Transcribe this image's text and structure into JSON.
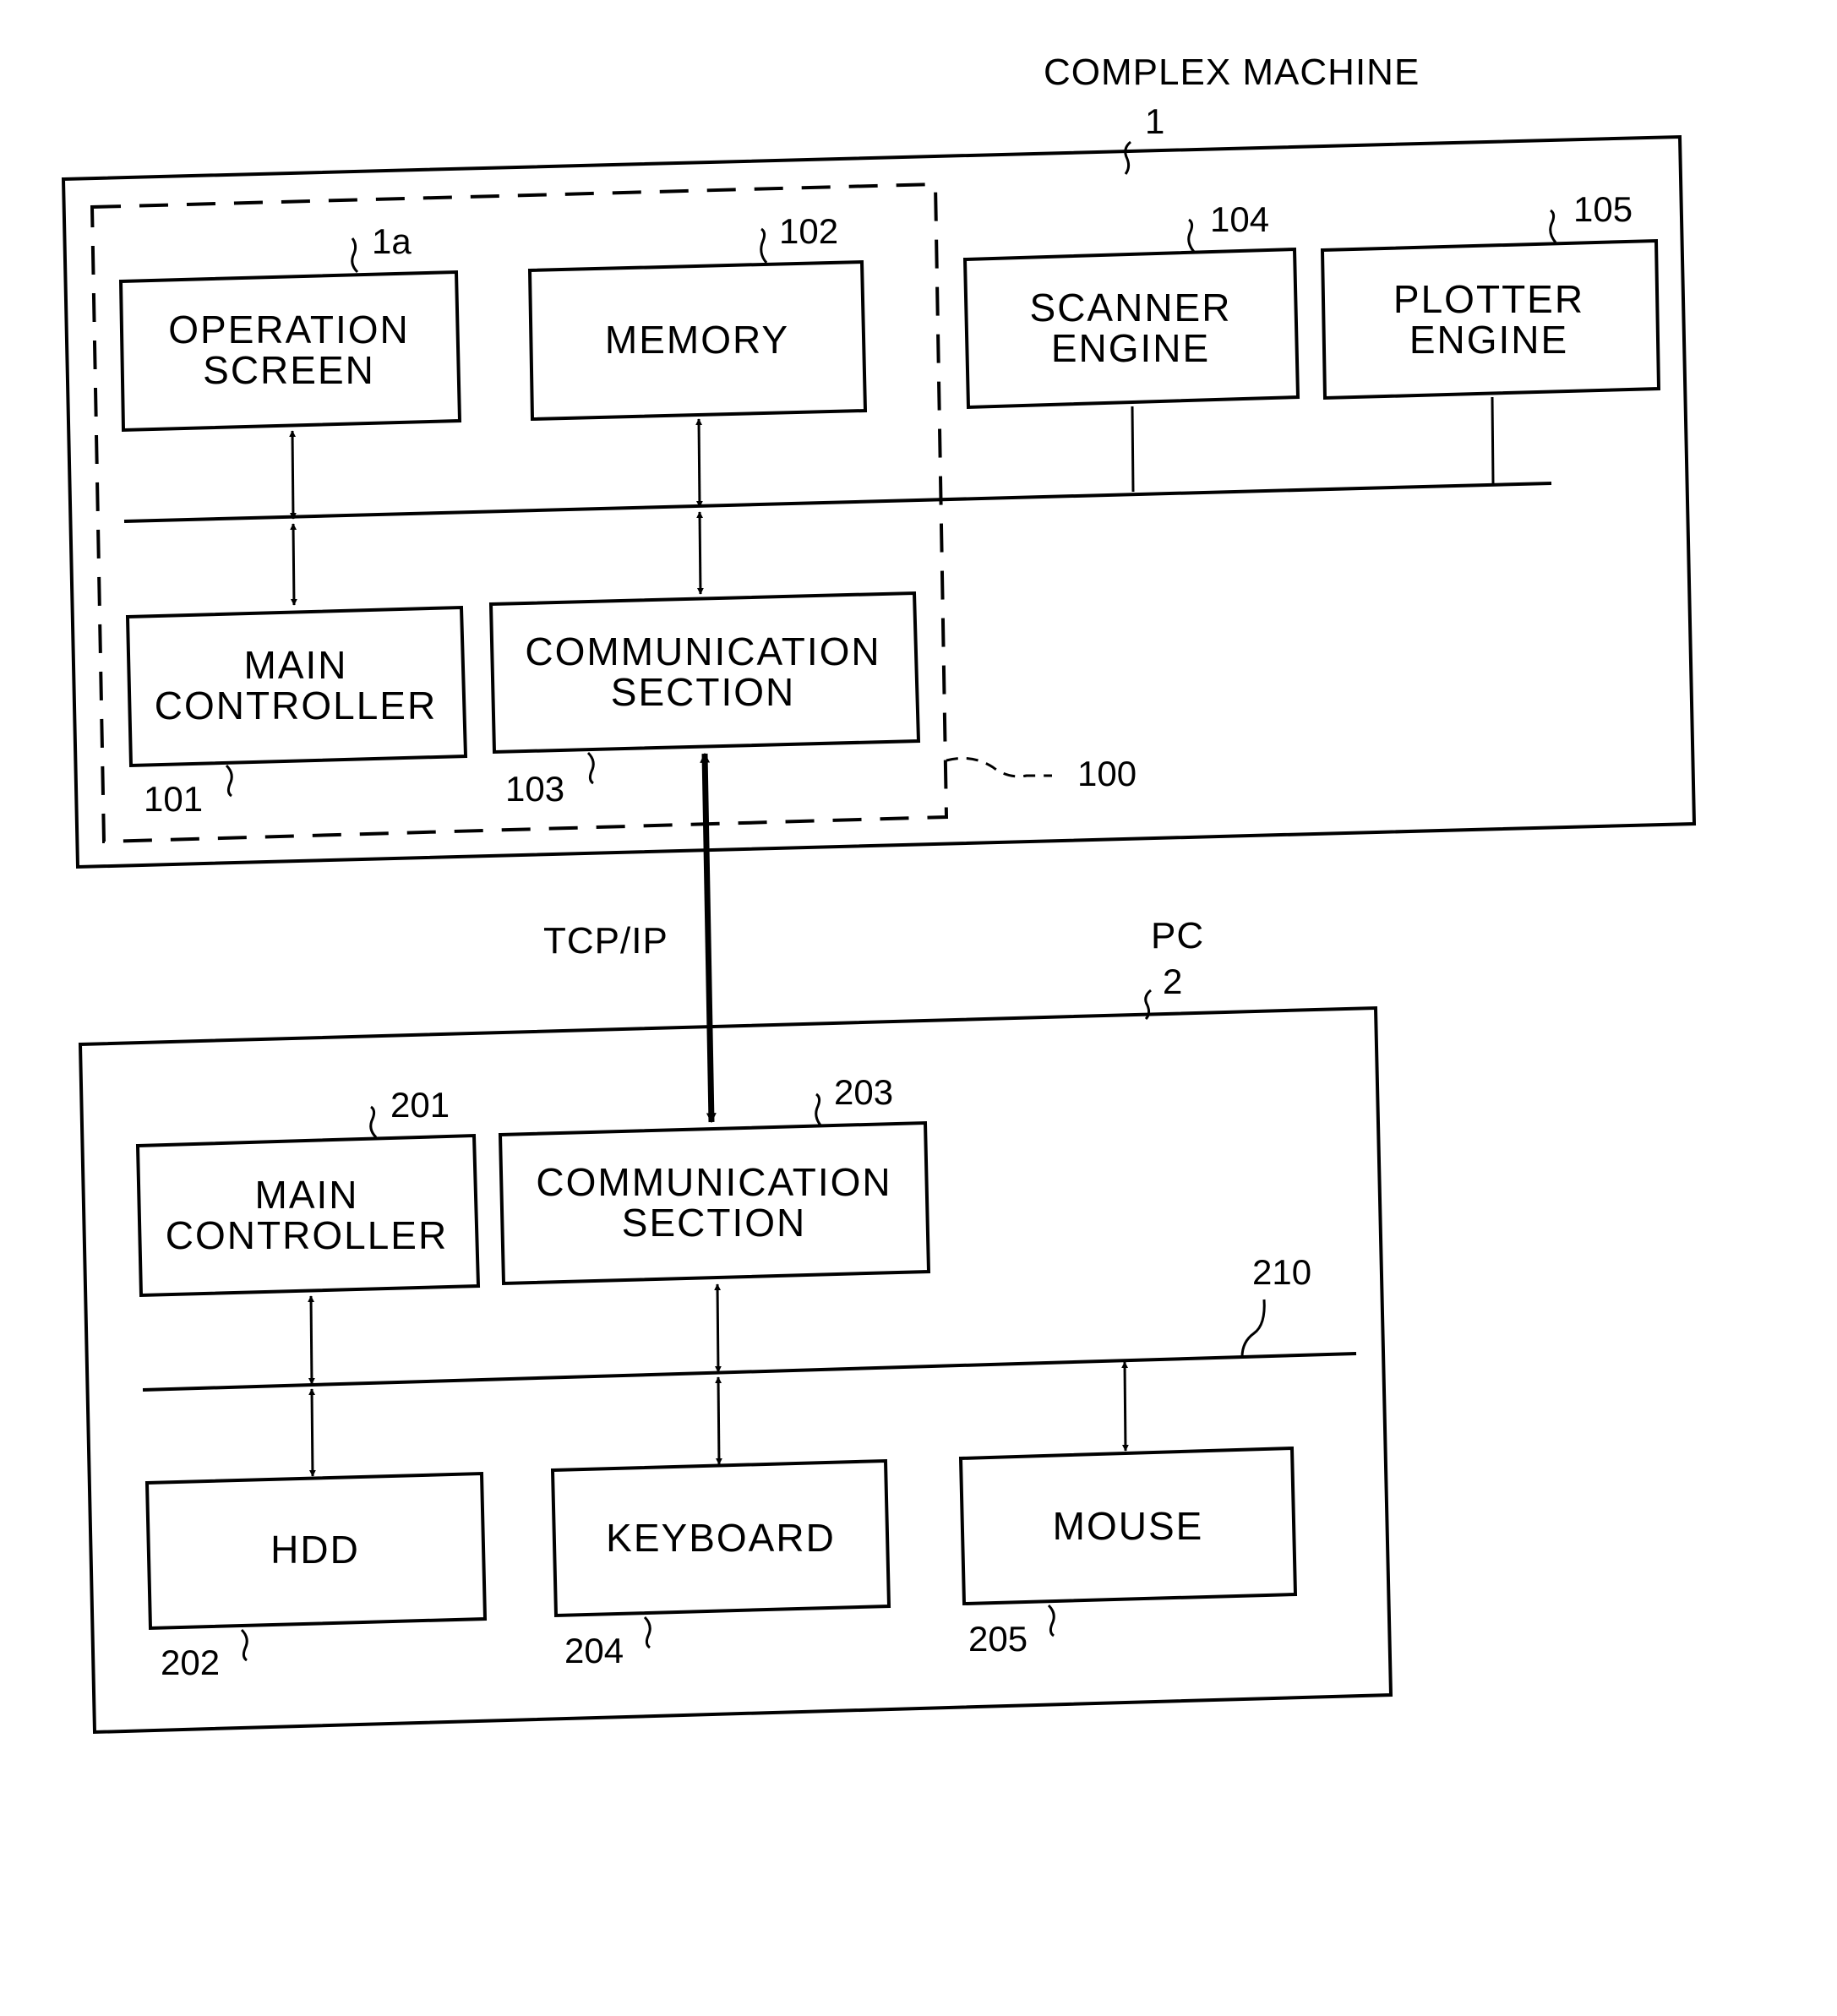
{
  "figure": {
    "complex_machine": {
      "title": "COMPLEX MACHINE",
      "ref": "1",
      "controller_group_ref": "100",
      "operation_screen": {
        "line1": "OPERATION",
        "line2": "SCREEN",
        "ref": "1a"
      },
      "memory": {
        "line1": "MEMORY",
        "ref": "102"
      },
      "scanner_engine": {
        "line1": "SCANNER",
        "line2": "ENGINE",
        "ref": "104"
      },
      "plotter_engine": {
        "line1": "PLOTTER",
        "line2": "ENGINE",
        "ref": "105"
      },
      "main_controller": {
        "line1": "MAIN",
        "line2": "CONTROLLER",
        "ref": "101"
      },
      "communication_section": {
        "line1": "COMMUNICATION",
        "line2": "SECTION",
        "ref": "103"
      }
    },
    "link": {
      "label": "TCP/IP"
    },
    "pc": {
      "title": "PC",
      "ref": "2",
      "bus_ref": "210",
      "main_controller": {
        "line1": "MAIN",
        "line2": "CONTROLLER",
        "ref": "201"
      },
      "communication_section": {
        "line1": "COMMUNICATION",
        "line2": "SECTION",
        "ref": "203"
      },
      "hdd": {
        "line1": "HDD",
        "ref": "202"
      },
      "keyboard": {
        "line1": "KEYBOARD",
        "ref": "204"
      },
      "mouse": {
        "line1": "MOUSE",
        "ref": "205"
      }
    }
  }
}
